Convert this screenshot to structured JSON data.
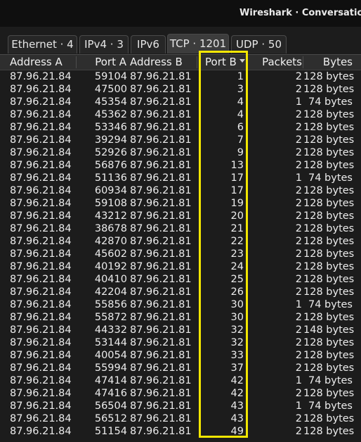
{
  "window": {
    "title": "Wireshark · Conversations · Blu"
  },
  "tabs": [
    {
      "label": "Ethernet · 4"
    },
    {
      "label": "IPv4 · 3"
    },
    {
      "label": "IPv6"
    },
    {
      "label": "TCP · 1201"
    },
    {
      "label": "UDP · 50"
    }
  ],
  "active_tab": "TCP · 1201",
  "table": {
    "columns": [
      "Address A",
      "Port A",
      "Address B",
      "Port B",
      "Packets",
      "Bytes"
    ],
    "sorted_column": "Port B",
    "sort_direction": "descending-indicator",
    "rows": [
      [
        "87.96.21.84",
        "59104",
        "87.96.21.81",
        "1",
        "2",
        "128 bytes"
      ],
      [
        "87.96.21.84",
        "47500",
        "87.96.21.81",
        "3",
        "2",
        "128 bytes"
      ],
      [
        "87.96.21.84",
        "45354",
        "87.96.21.81",
        "4",
        "1",
        "74 bytes"
      ],
      [
        "87.96.21.84",
        "45362",
        "87.96.21.81",
        "4",
        "2",
        "128 bytes"
      ],
      [
        "87.96.21.84",
        "53346",
        "87.96.21.81",
        "6",
        "2",
        "128 bytes"
      ],
      [
        "87.96.21.84",
        "39294",
        "87.96.21.81",
        "7",
        "2",
        "128 bytes"
      ],
      [
        "87.96.21.84",
        "52926",
        "87.96.21.81",
        "9",
        "2",
        "128 bytes"
      ],
      [
        "87.96.21.84",
        "56876",
        "87.96.21.81",
        "13",
        "2",
        "128 bytes"
      ],
      [
        "87.96.21.84",
        "51136",
        "87.96.21.81",
        "17",
        "1",
        "74 bytes"
      ],
      [
        "87.96.21.84",
        "60934",
        "87.96.21.81",
        "17",
        "2",
        "128 bytes"
      ],
      [
        "87.96.21.84",
        "59108",
        "87.96.21.81",
        "19",
        "2",
        "128 bytes"
      ],
      [
        "87.96.21.84",
        "43212",
        "87.96.21.81",
        "20",
        "2",
        "128 bytes"
      ],
      [
        "87.96.21.84",
        "38678",
        "87.96.21.81",
        "21",
        "2",
        "128 bytes"
      ],
      [
        "87.96.21.84",
        "42870",
        "87.96.21.81",
        "22",
        "2",
        "128 bytes"
      ],
      [
        "87.96.21.84",
        "45602",
        "87.96.21.81",
        "23",
        "2",
        "128 bytes"
      ],
      [
        "87.96.21.84",
        "40192",
        "87.96.21.81",
        "24",
        "2",
        "128 bytes"
      ],
      [
        "87.96.21.84",
        "40410",
        "87.96.21.81",
        "25",
        "2",
        "128 bytes"
      ],
      [
        "87.96.21.84",
        "42204",
        "87.96.21.81",
        "26",
        "2",
        "128 bytes"
      ],
      [
        "87.96.21.84",
        "55856",
        "87.96.21.81",
        "30",
        "1",
        "74 bytes"
      ],
      [
        "87.96.21.84",
        "55872",
        "87.96.21.81",
        "30",
        "2",
        "128 bytes"
      ],
      [
        "87.96.21.84",
        "44332",
        "87.96.21.81",
        "32",
        "2",
        "148 bytes"
      ],
      [
        "87.96.21.84",
        "53144",
        "87.96.21.81",
        "32",
        "2",
        "128 bytes"
      ],
      [
        "87.96.21.84",
        "40054",
        "87.96.21.81",
        "33",
        "2",
        "128 bytes"
      ],
      [
        "87.96.21.84",
        "55994",
        "87.96.21.81",
        "37",
        "2",
        "128 bytes"
      ],
      [
        "87.96.21.84",
        "47414",
        "87.96.21.81",
        "42",
        "1",
        "74 bytes"
      ],
      [
        "87.96.21.84",
        "47416",
        "87.96.21.81",
        "42",
        "2",
        "128 bytes"
      ],
      [
        "87.96.21.84",
        "56504",
        "87.96.21.81",
        "43",
        "1",
        "74 bytes"
      ],
      [
        "87.96.21.84",
        "56512",
        "87.96.21.81",
        "43",
        "2",
        "128 bytes"
      ],
      [
        "87.96.21.84",
        "51154",
        "87.96.21.81",
        "49",
        "2",
        "128 bytes"
      ]
    ]
  },
  "colors": {
    "highlight": "#f2e600",
    "background": "#1c1c1c",
    "header": "#2e2e2e"
  }
}
